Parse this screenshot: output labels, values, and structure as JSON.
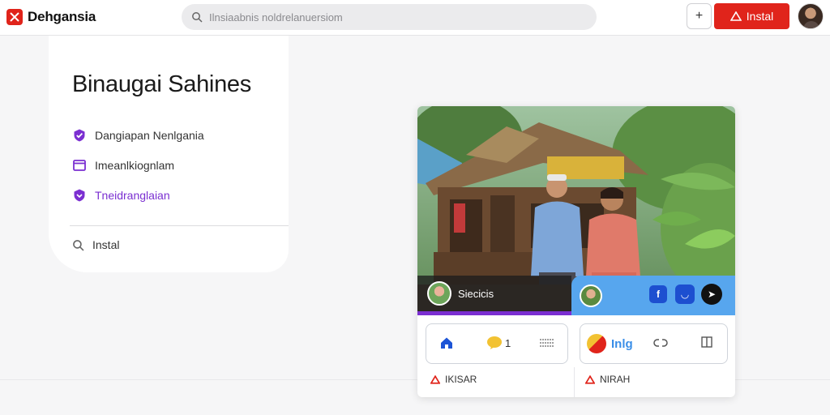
{
  "app": {
    "name": "Dehgansia"
  },
  "search": {
    "placeholder": "Ilnsiaabnis noldrelanuersiom"
  },
  "header": {
    "add_label": "+",
    "install_label": "Instal"
  },
  "panel": {
    "title": "Binaugai Sahines",
    "items": [
      {
        "label": "Dangiapan Nenlgania",
        "icon": "check-shield-icon"
      },
      {
        "label": "Imeanlkiognlam",
        "icon": "window-icon"
      },
      {
        "label": "Tneidranglaian",
        "icon": "shield-icon"
      }
    ],
    "install_label": "Instal"
  },
  "card": {
    "hero_left_label": "Siecicis",
    "footer_left": "IKISAR",
    "footer_right": "NIRAH",
    "logo_text": "Inlg",
    "chat_count": "1"
  },
  "colors": {
    "brand": "#e0241b",
    "accent": "#7b2fd1",
    "blue": "#57a6ee"
  }
}
